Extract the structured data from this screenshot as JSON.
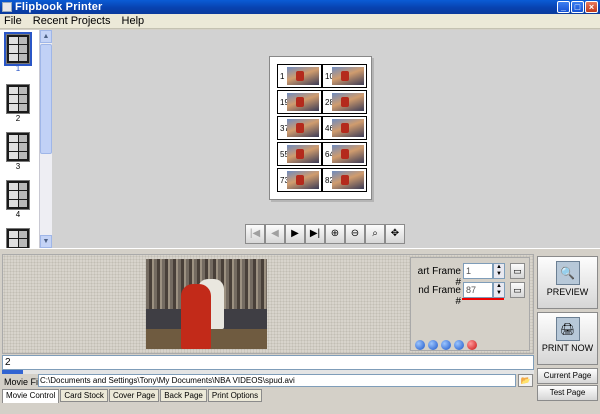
{
  "window": {
    "title": "Flipbook Printer"
  },
  "menu": [
    "File",
    "Recent Projects",
    "Help"
  ],
  "thumbnails": [
    "1",
    "2",
    "3",
    "4"
  ],
  "page_cells": [
    "1",
    "10",
    "19",
    "28",
    "37",
    "46",
    "55",
    "64",
    "73",
    "82"
  ],
  "nav_buttons": [
    {
      "name": "first-page-icon",
      "glyph": "|◀"
    },
    {
      "name": "prev-page-icon",
      "glyph": "◀"
    },
    {
      "name": "next-page-icon",
      "glyph": "▶"
    },
    {
      "name": "last-page-icon",
      "glyph": "▶|"
    },
    {
      "name": "zoom-in-icon",
      "glyph": "⊕"
    },
    {
      "name": "zoom-out-icon",
      "glyph": "⊖"
    },
    {
      "name": "zoom-fit-icon",
      "glyph": "⌕"
    },
    {
      "name": "pan-icon",
      "glyph": "✥"
    }
  ],
  "frames": {
    "start_label": "art Frame #",
    "start_value": "1",
    "end_label": "nd Frame #",
    "end_value": "87"
  },
  "preview_button": "PREVIEW",
  "print_now_button": "PRINT NOW",
  "current_page_button": "Current Page",
  "test_page_button": "Test Page",
  "frame_input_value": "2",
  "progress_fraction": 0.04,
  "movie": {
    "label": "Movie Fil",
    "path": "C:\\Documents and Settings\\Tony\\My Documents\\NBA VIDEOS\\spud.avi"
  },
  "tabs": [
    "Movie Control",
    "Card Stock",
    "Cover Page",
    "Back Page",
    "Print Options"
  ],
  "colors": {
    "titlebar": "#0842b0",
    "accent_red": "#e00000",
    "selection": "#2a56c6"
  }
}
